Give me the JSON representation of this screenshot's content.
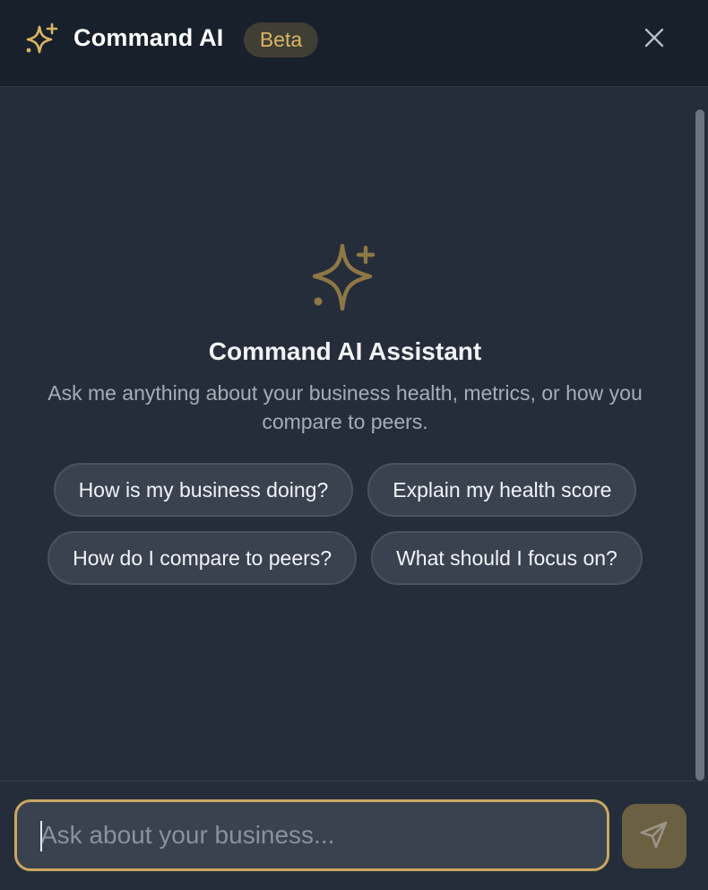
{
  "header": {
    "title": "Command AI",
    "badge": "Beta",
    "logo_icon": "sparkles-icon",
    "close_icon": "close-icon"
  },
  "empty_state": {
    "icon": "sparkles-icon",
    "title": "Command AI Assistant",
    "description": "Ask me anything about your business health, metrics, or how you compare to peers."
  },
  "suggestions": [
    "How is my business doing?",
    "Explain my health score",
    "How do I compare to peers?",
    "What should I focus on?"
  ],
  "composer": {
    "placeholder": "Ask about your business...",
    "value": "",
    "send_icon": "send-icon"
  },
  "colors": {
    "accent": "#c9a85f",
    "header_bg": "#18202c",
    "panel_bg": "#262d3a",
    "chip_bg": "#3a4250"
  }
}
